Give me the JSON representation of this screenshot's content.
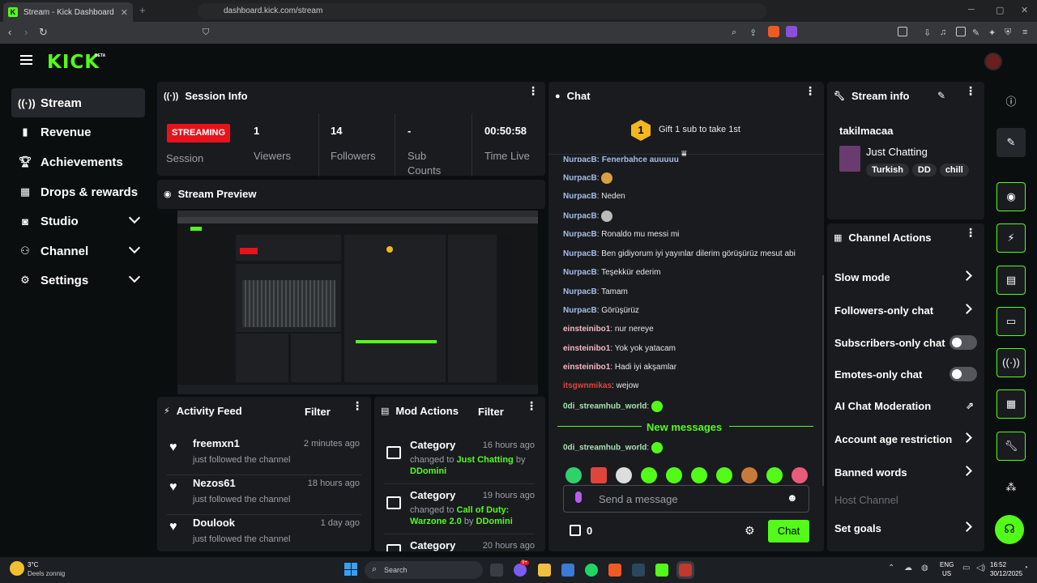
{
  "browser": {
    "tab_title": "Stream - Kick Dashboard",
    "url": "dashboard.kick.com/stream"
  },
  "app": {
    "logo": "KICK",
    "logo_badge": "BETA"
  },
  "sidebar": {
    "items": [
      {
        "label": "Stream",
        "icon": "broadcast-icon"
      },
      {
        "label": "Revenue",
        "icon": "chart-icon"
      },
      {
        "label": "Achievements",
        "icon": "trophy-icon"
      },
      {
        "label": "Drops & rewards",
        "icon": "gift-icon"
      },
      {
        "label": "Studio",
        "icon": "studio-icon"
      },
      {
        "label": "Channel",
        "icon": "channel-icon"
      },
      {
        "label": "Settings",
        "icon": "gear-icon"
      }
    ]
  },
  "session": {
    "title": "Session Info",
    "status": "STREAMING",
    "session_label": "Session",
    "stats": [
      {
        "value": "1",
        "label": "Viewers"
      },
      {
        "value": "14",
        "label": "Followers"
      },
      {
        "value": "-",
        "label": "Sub Counts"
      },
      {
        "value": "00:50:58",
        "label": "Time Live"
      }
    ]
  },
  "preview": {
    "title": "Stream Preview"
  },
  "activity": {
    "title": "Activity Feed",
    "filter": "Filter",
    "items": [
      {
        "name": "freemxn1",
        "time": "2 minutes ago",
        "desc": "just followed the channel"
      },
      {
        "name": "Nezos61",
        "time": "18 hours ago",
        "desc": "just followed the channel"
      },
      {
        "name": "Doulook",
        "time": "1 day ago",
        "desc": "just followed the channel"
      }
    ]
  },
  "mod": {
    "title": "Mod Actions",
    "filter": "Filter",
    "items": [
      {
        "name": "Category",
        "time": "16 hours ago",
        "prefix": "changed to",
        "value": "Just Chatting",
        "by": "by",
        "user": "DDomini"
      },
      {
        "name": "Category",
        "time": "19 hours ago",
        "prefix": "changed to",
        "value": "Call of Duty: Warzone 2.0",
        "by": "by",
        "user": "DDomini"
      },
      {
        "name": "Category",
        "time": "20 hours ago"
      }
    ]
  },
  "chat": {
    "title": "Chat",
    "gift_badge": "1",
    "gift_text": "Gift 1 sub to take 1st",
    "partial_top": "NurpacB: Fenerbahçe auuuuu",
    "messages": [
      {
        "user": "NurpacB",
        "text": "",
        "emote": true
      },
      {
        "user": "NurpacB",
        "text": "Neden"
      },
      {
        "user": "NurpacB",
        "text": "",
        "emote": true
      },
      {
        "user": "NurpacB",
        "text": "Ronaldo mu messi mi"
      },
      {
        "user": "NurpacB",
        "text": "Ben gidiyorum iyi yayınlar dilerim görüşürüz mesut abi"
      },
      {
        "user": "NurpacB",
        "text": "Teşekkür ederim"
      },
      {
        "user": "NurpacB",
        "text": "Tamam"
      },
      {
        "user": "NurpacB",
        "text": "Görüşürüz"
      },
      {
        "user": "einsteinibo1",
        "text": "nur nereye"
      },
      {
        "user": "einsteinibo1",
        "text": "Yok yok yatacam"
      },
      {
        "user": "einsteinibo1",
        "text": "Hadi iyi akşamlar"
      },
      {
        "user": "itsgwnmikas",
        "text": "wejow"
      },
      {
        "user": "0di_streamhub_world",
        "text": "",
        "emote": true
      }
    ],
    "new_messages": "New messages",
    "after_new": {
      "user": "0di_streamhub_world",
      "text": "",
      "emote": true
    },
    "input_placeholder": "Send a message",
    "points": "0",
    "send_button": "Chat"
  },
  "stream_info": {
    "title": "Stream info",
    "channel": "takilmacaa",
    "category": "Just Chatting",
    "tags": [
      "Turkish",
      "DD",
      "chill"
    ]
  },
  "channel_actions": {
    "title": "Channel Actions",
    "items": [
      {
        "label": "Slow mode",
        "kind": "chevron"
      },
      {
        "label": "Followers-only chat",
        "kind": "chevron"
      },
      {
        "label": "Subscribers-only chat",
        "kind": "toggle"
      },
      {
        "label": "Emotes-only chat",
        "kind": "toggle"
      },
      {
        "label": "AI Chat Moderation",
        "kind": "external"
      },
      {
        "label": "Account age restriction",
        "kind": "chevron"
      },
      {
        "label": "Banned words",
        "kind": "chevron"
      },
      {
        "label": "Host Channel",
        "kind": "disabled"
      },
      {
        "label": "Set goals",
        "kind": "chevron"
      }
    ]
  },
  "taskbar": {
    "weather_temp": "3°C",
    "weather_desc": "Deels zonnig",
    "search": "Search",
    "lang": "ENG",
    "region": "US",
    "time": "16:52",
    "date": "30/12/2025",
    "badge": "9+"
  },
  "colors": {
    "accent": "#53fc18",
    "live": "#e8121b",
    "panel": "#191b1f"
  }
}
